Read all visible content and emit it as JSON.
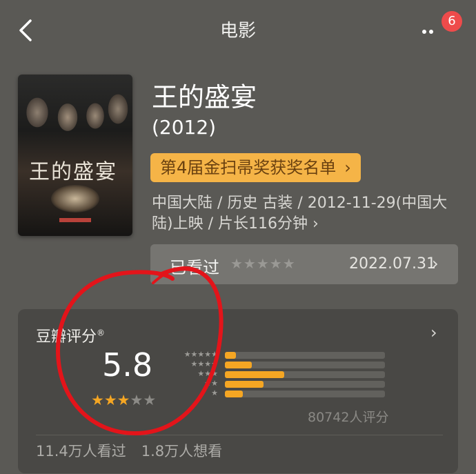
{
  "header": {
    "title": "电影",
    "badge_count": "6"
  },
  "movie": {
    "title": "王的盛宴",
    "year": "(2012)",
    "award_label": "第4届金扫帚奖获奖名单",
    "award_chevron": "›",
    "meta_line1": "中国大陆 / 历史 古装 / 2012-11-29(中国大",
    "meta_line2": "陆)上映 / 片长116分钟 ›",
    "poster_title": "王的盛宴"
  },
  "watched": {
    "label": "已看过",
    "stars": "★★★★★",
    "date": "2022.07.31",
    "chevron": "›"
  },
  "rating": {
    "title": "豆瓣评分",
    "title_mark": "®",
    "chevron": "›",
    "score": "5.8",
    "stars_filled": 3,
    "stars_total": 5,
    "count_label": "80742人评分",
    "distribution": [
      {
        "stars": "★★★★★",
        "fraction": 0.07
      },
      {
        "stars": "★★★★",
        "fraction": 0.17
      },
      {
        "stars": "★★★",
        "fraction": 0.37
      },
      {
        "stars": "★★",
        "fraction": 0.24
      },
      {
        "stars": "★",
        "fraction": 0.11
      }
    ]
  },
  "stats": {
    "watched": "11.4万人看过",
    "want": "1.8万人想看"
  },
  "colors": {
    "background": "#5a5955",
    "accent": "#f5a623",
    "award_pill": "#f5b447",
    "annotation": "#e3141a",
    "badge": "#ee4b4b"
  },
  "icons": {
    "back": "back-arrow-icon",
    "more": "more-dots-icon"
  }
}
